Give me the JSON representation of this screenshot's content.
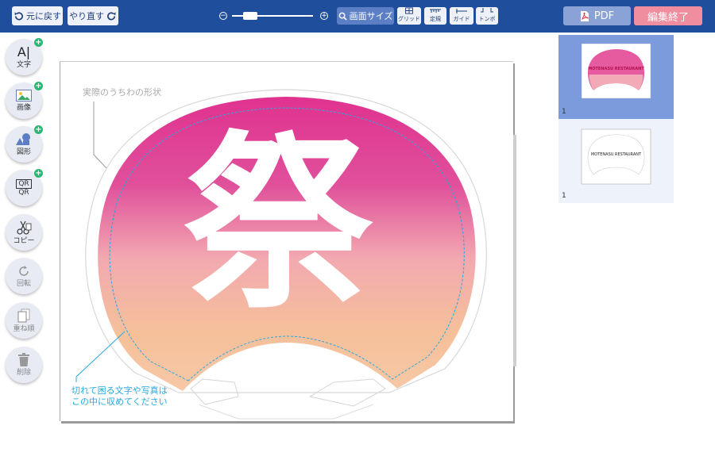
{
  "toolbar": {
    "undo_label": "元に戻す",
    "redo_label": "やり直す",
    "zoom_minus": "−",
    "zoom_plus": "+",
    "screen_size_label": "画面サイズ",
    "grid_label": "グリッド",
    "ruler_label": "定規",
    "guide_label": "ガイド",
    "tombo_label": "トンボ",
    "pdf_label": "PDF",
    "finish_label": "編集終了"
  },
  "sidebar": {
    "items": [
      {
        "label": "文字",
        "icon": "text-icon"
      },
      {
        "label": "画像",
        "icon": "image-icon"
      },
      {
        "label": "図形",
        "icon": "shape-icon"
      },
      {
        "label": "QR",
        "icon": "qr-icon"
      },
      {
        "label": "コピー",
        "icon": "scissors-icon"
      },
      {
        "label": "回転",
        "icon": "rotate-icon"
      },
      {
        "label": "重ね順",
        "icon": "layer-order-icon"
      },
      {
        "label": "削除",
        "icon": "trash-icon"
      }
    ],
    "text_glyph": "A|",
    "qr_glyph": "QR"
  },
  "canvas": {
    "shape_note": "実際のうちわの形状",
    "main_kanji": "祭",
    "cut_note_line1": "切れて困る文字や写真は",
    "cut_note_line2": "この中に収めてください"
  },
  "thumbnails": [
    {
      "page": "1",
      "text": "MOTENASU RESTAURANT"
    },
    {
      "page": "1",
      "text": "MOTENASU RESTAURANT"
    }
  ],
  "colors": {
    "topbar": "#1f4e9c",
    "finish": "#f08ea0",
    "pdf": "#8aa2d6",
    "guide_line": "#29a8e0",
    "selected_thumb": "#7b9bdd"
  }
}
